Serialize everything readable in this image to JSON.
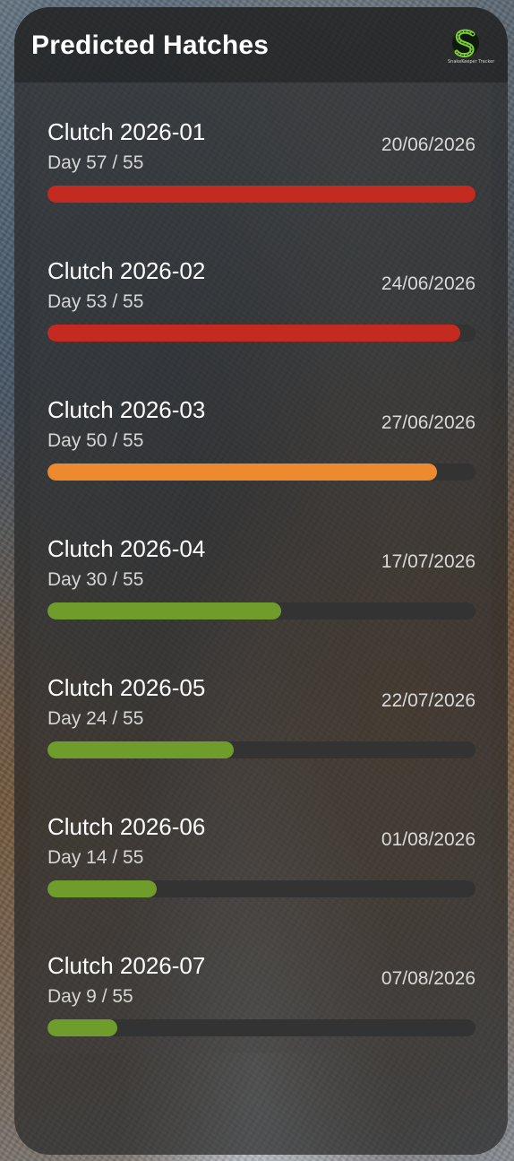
{
  "title": "Predicted Hatches",
  "logo": {
    "icon": "snake-s-logo-icon",
    "text": "SnakeKeeper Tracker"
  },
  "colors": {
    "bar_red": "#c42b20",
    "bar_orange": "#ee8a2e",
    "bar_green": "#6e9d2c",
    "track": "#333333"
  },
  "clutches": [
    {
      "name": "Clutch 2026-01",
      "day": "Day 57 / 55",
      "date": "20/06/2026",
      "progress": 1.0,
      "status": "red"
    },
    {
      "name": "Clutch 2026-02",
      "day": "Day 53 / 55",
      "date": "24/06/2026",
      "progress": 0.964,
      "status": "red"
    },
    {
      "name": "Clutch 2026-03",
      "day": "Day 50 / 55",
      "date": "27/06/2026",
      "progress": 0.909,
      "status": "orange"
    },
    {
      "name": "Clutch 2026-04",
      "day": "Day 30 / 55",
      "date": "17/07/2026",
      "progress": 0.545,
      "status": "green"
    },
    {
      "name": "Clutch 2026-05",
      "day": "Day 24 / 55",
      "date": "22/07/2026",
      "progress": 0.436,
      "status": "green"
    },
    {
      "name": "Clutch 2026-06",
      "day": "Day 14 / 55",
      "date": "01/08/2026",
      "progress": 0.255,
      "status": "green"
    },
    {
      "name": "Clutch 2026-07",
      "day": "Day 9 / 55",
      "date": "07/08/2026",
      "progress": 0.164,
      "status": "green"
    }
  ]
}
